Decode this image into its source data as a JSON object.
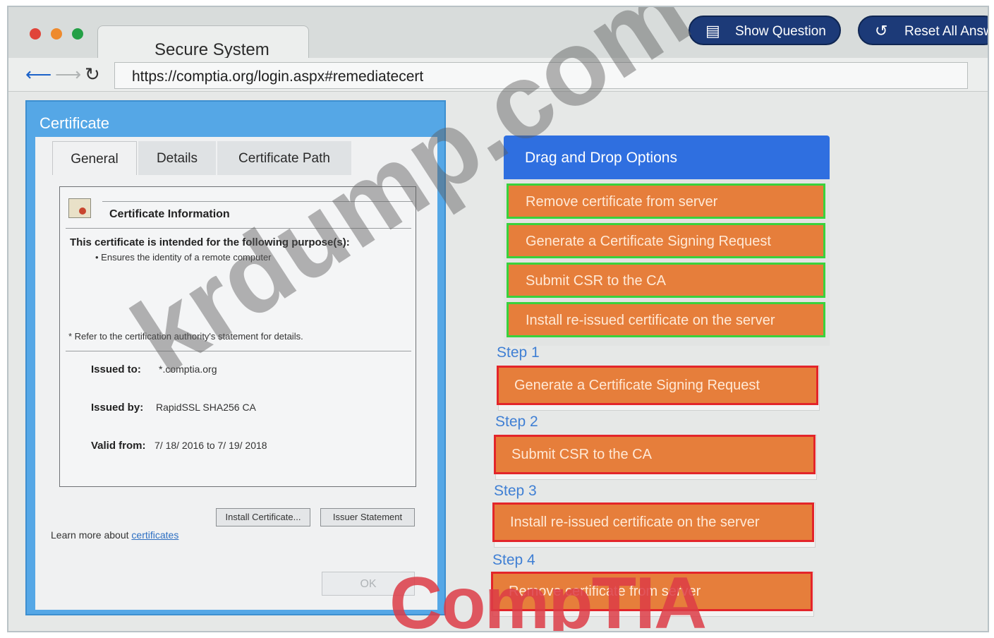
{
  "browser": {
    "tab_title": "Secure System",
    "url": "https://comptia.org/login.aspx#remediatecert",
    "back_icon": "back-arrow-icon",
    "forward_icon": "forward-arrow-icon",
    "reload_icon": "reload-icon"
  },
  "toolbar": {
    "show_question": "Show Question",
    "reset_all": "Reset All Answ"
  },
  "certificate": {
    "title": "Certificate",
    "tabs": [
      "General",
      "Details",
      "Certificate Path"
    ],
    "info_heading": "Certificate Information",
    "purpose_heading": "This certificate is intended for the following purpose(s):",
    "purpose_item": "• Ensures the identity of a remote computer",
    "refer_note": "* Refer to the certification authority's statement for details.",
    "issued_to_label": "Issued to:",
    "issued_to_value": "*.comptia.org",
    "issued_by_label": "Issued by:",
    "issued_by_value": "RapidSSL SHA256 CA",
    "valid_from_label": "Valid from:",
    "valid_from_value": "7/ 18/ 2016  to  7/ 19/ 2018",
    "install_button": "Install Certificate...",
    "issuer_button": "Issuer Statement",
    "learn_more_prefix": "Learn more about ",
    "learn_more_link": "certificates",
    "ok_button": "OK"
  },
  "drag_drop": {
    "header": "Drag and Drop Options",
    "options": [
      "Remove certificate from server",
      "Generate a Certificate Signing Request",
      "Submit CSR to the CA",
      "Install re-issued certificate on the server"
    ],
    "steps": [
      {
        "label": "Step 1",
        "value": "Generate a Certificate Signing Request"
      },
      {
        "label": "Step 2",
        "value": "Submit CSR to the CA"
      },
      {
        "label": "Step 3",
        "value": "Install re-issued certificate on the server"
      },
      {
        "label": "Step 4",
        "value": "Remove certificate from server"
      }
    ]
  },
  "watermarks": {
    "krdump": "krdump.com",
    "comptia": "CompTIA"
  },
  "colors": {
    "dialog_blue": "#55a7e6",
    "header_blue": "#2f6fe0",
    "option_orange": "#e67e3b",
    "option_border_green": "#39d23c",
    "step_border_red": "#e3252a",
    "step_label_blue": "#3f7fd4",
    "button_navy": "#1c3a78"
  }
}
